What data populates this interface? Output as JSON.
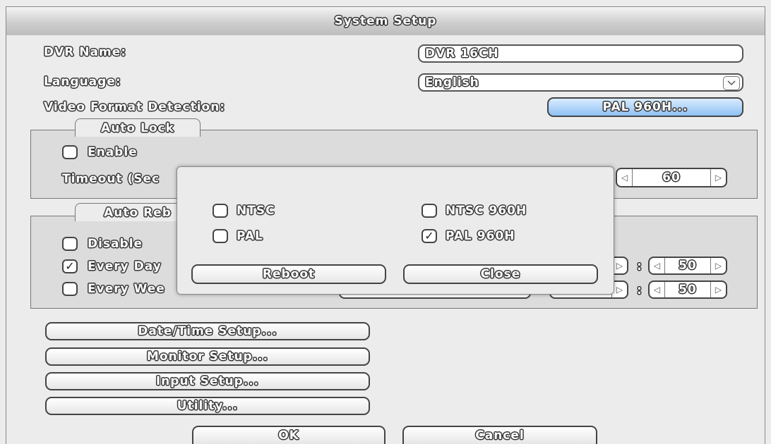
{
  "window": {
    "title": "System Setup"
  },
  "settings": {
    "dvr_name_label": "DVR Name:",
    "dvr_name_value": "DVR 16CH",
    "language_label": "Language:",
    "language_value": "English",
    "video_format_label": "Video Format Detection:",
    "video_format_button": "PAL 960H..."
  },
  "auto_lock": {
    "title": "Auto Lock",
    "enable_label": "Enable",
    "enable_checked": false,
    "timeout_label": "Timeout (Sec",
    "timeout_value": "60"
  },
  "auto_reboot": {
    "title": "Auto Reb",
    "disable_label": "Disable",
    "disable_checked": false,
    "every_day_label": "Every Day",
    "every_day_checked": true,
    "every_week_label": "Every Wee",
    "every_week_checked": false,
    "separator": ":",
    "day_minute": "50",
    "week_minute": "50"
  },
  "nav_buttons": {
    "datetime": "Date/Time Setup...",
    "monitor": "Monitor Setup...",
    "input": "Input Setup...",
    "utility": "Utility..."
  },
  "footer": {
    "ok": "OK",
    "cancel": "Cancel"
  },
  "video_dialog": {
    "ntsc_label": "NTSC",
    "ntsc_checked": false,
    "ntsc960_label": "NTSC 960H",
    "ntsc960_checked": false,
    "pal_label": "PAL",
    "pal_checked": false,
    "pal960_label": "PAL 960H",
    "pal960_checked": true,
    "reboot_label": "Reboot",
    "close_label": "Close"
  },
  "icons": {
    "check": "✓",
    "dropdown": "chevron-down-icon",
    "left": "◁",
    "right": "▷"
  },
  "colors": {
    "accent_button": "#8fc1f3",
    "group_bg": "#dcdcdc",
    "window_bg": "#ececec"
  }
}
